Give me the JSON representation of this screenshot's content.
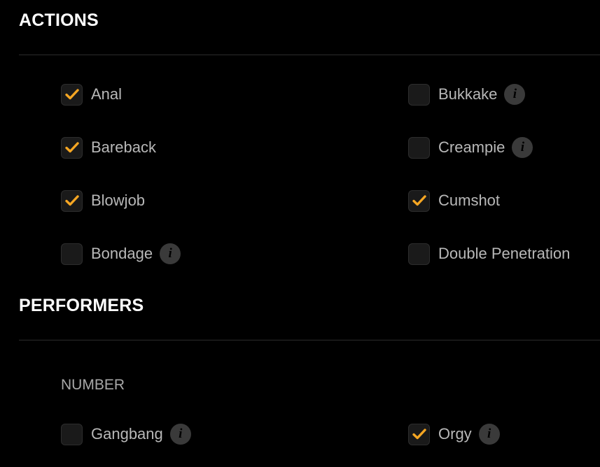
{
  "sections": {
    "actions": {
      "title": "ACTIONS",
      "options": [
        {
          "label": "Anal",
          "checked": true,
          "info": false
        },
        {
          "label": "Bukkake",
          "checked": false,
          "info": true
        },
        {
          "label": "Bareback",
          "checked": true,
          "info": false
        },
        {
          "label": "Creampie",
          "checked": false,
          "info": true
        },
        {
          "label": "Blowjob",
          "checked": true,
          "info": false
        },
        {
          "label": "Cumshot",
          "checked": true,
          "info": false
        },
        {
          "label": "Bondage",
          "checked": false,
          "info": true
        },
        {
          "label": "Double Penetration",
          "checked": false,
          "info": false
        }
      ]
    },
    "performers": {
      "title": "PERFORMERS",
      "number_heading": "NUMBER",
      "options": [
        {
          "label": "Gangbang",
          "checked": false,
          "info": true
        },
        {
          "label": "Orgy",
          "checked": true,
          "info": true
        }
      ]
    }
  },
  "info_glyph": "i",
  "icons": {
    "check": "check-icon",
    "info": "info-icon"
  },
  "colors": {
    "accent": "#f5a623",
    "background": "#000000",
    "checkbox_bg": "#1a1a1a",
    "info_bg": "#3a3a3a"
  }
}
